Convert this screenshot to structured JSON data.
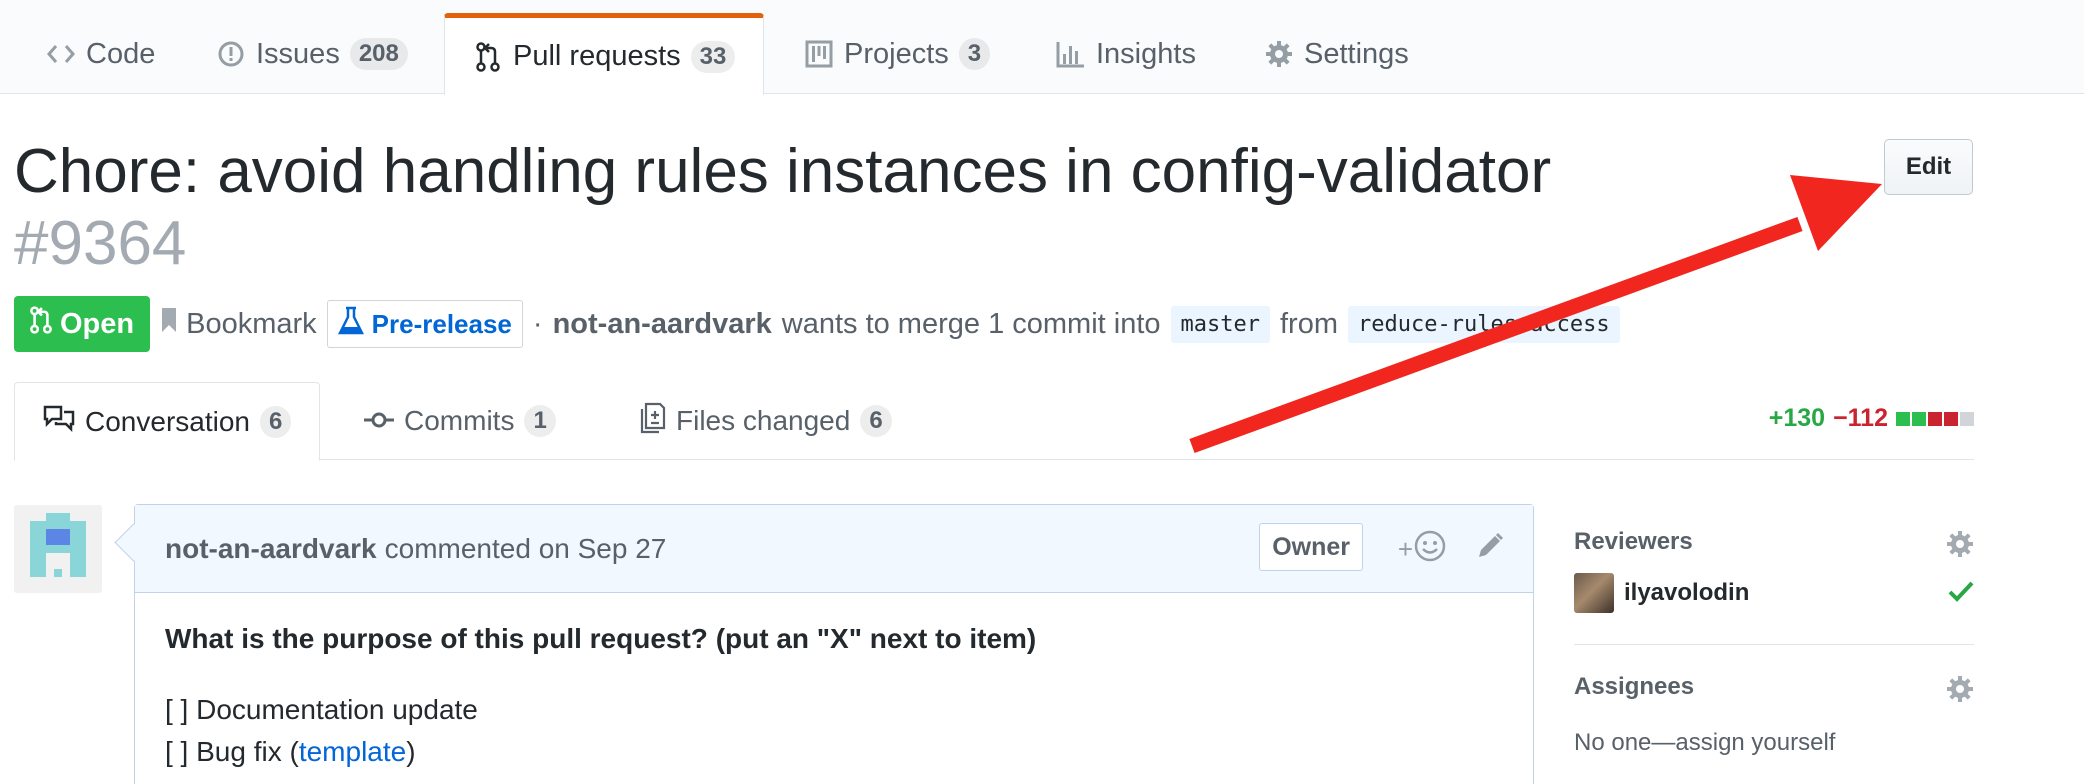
{
  "repo_nav": {
    "tabs": [
      {
        "label": "Code",
        "counter": null,
        "icon": "code-icon"
      },
      {
        "label": "Issues",
        "counter": "208",
        "icon": "issue-icon"
      },
      {
        "label": "Pull requests",
        "counter": "33",
        "icon": "pull-request-icon",
        "selected": true
      },
      {
        "label": "Projects",
        "counter": "3",
        "icon": "project-icon"
      },
      {
        "label": "Insights",
        "counter": null,
        "icon": "graph-icon"
      },
      {
        "label": "Settings",
        "counter": null,
        "icon": "gear-icon"
      }
    ]
  },
  "header": {
    "title": "Chore: avoid handling rules instances in config-validator",
    "number": "#9364",
    "edit_label": "Edit"
  },
  "meta": {
    "state": "Open",
    "bookmark": "Bookmark",
    "prerelease": "Pre-release",
    "separator": "·",
    "author": "not-an-aardvark",
    "text_merge": "wants to merge 1 commit into",
    "base_branch": "master",
    "text_from": "from",
    "head_branch": "reduce-rules-access"
  },
  "pr_tabs": [
    {
      "label": "Conversation",
      "counter": "6",
      "icon": "comment-discussion-icon",
      "selected": true
    },
    {
      "label": "Commits",
      "counter": "1",
      "icon": "git-commit-icon"
    },
    {
      "label": "Files changed",
      "counter": "6",
      "icon": "file-diff-icon"
    }
  ],
  "diffstat": {
    "additions": "+130",
    "deletions": "−112",
    "blocks": [
      "green",
      "green",
      "red",
      "red",
      "grey"
    ],
    "colors": {
      "green": "#2cbe4e",
      "red": "#cb2431",
      "grey": "#d1d5da"
    }
  },
  "comment": {
    "author": "not-an-aardvark",
    "action": "commented on Sep 27",
    "badge": "Owner",
    "reaction_plus": "+",
    "question": "What is the purpose of this pull request? (put an \"X\" next to item)",
    "items": [
      {
        "text": "[ ] Documentation update"
      },
      {
        "text_before": "[ ] Bug fix (",
        "link": "template",
        "text_after": ")"
      }
    ]
  },
  "sidebar": {
    "reviewers_heading": "Reviewers",
    "reviewer_name": "ilyavolodin",
    "assignees_heading": "Assignees",
    "assignees_empty": "No one—assign yourself"
  },
  "colors": {
    "accent_tab": "#e36209",
    "open_green": "#2cbe4e",
    "link_blue": "#0366d6",
    "annotation_red": "#f0261f"
  }
}
